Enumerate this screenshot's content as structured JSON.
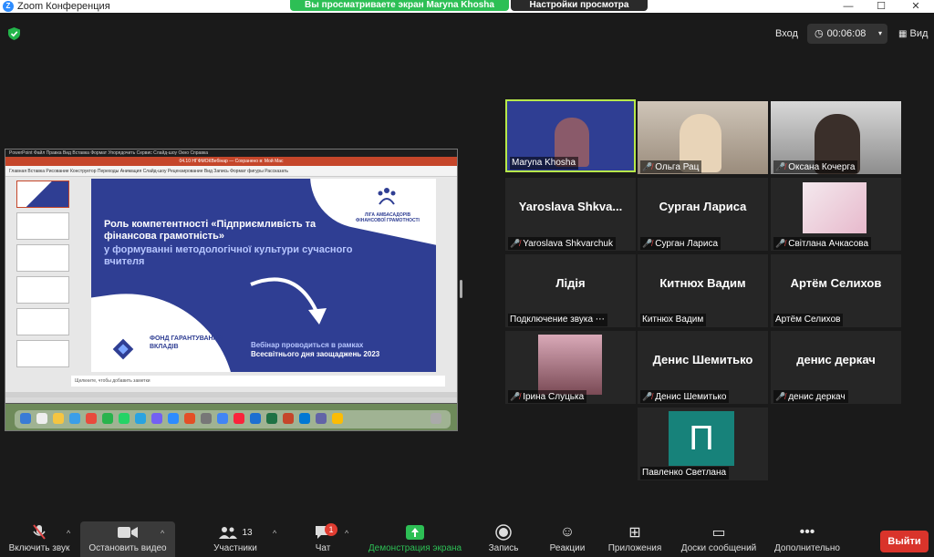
{
  "window": {
    "title": "Zoom Конференция",
    "share_banner": "Вы просматриваете экран Maryna Khosha",
    "view_options": "Настройки просмотра"
  },
  "topbar": {
    "enter_label": "Вход",
    "timer": "00:06:08",
    "view_label": "Вид"
  },
  "ppt": {
    "menubar": "PowerPoint   Файл   Правка   Вид   Вставка   Формат   Упорядочить   Сервис   Слайд-шоу   Окно   Справка",
    "doc_title": "04.10 НГФМОКВебінар — Сохранено в: Мой Mac",
    "ribbon": "Главная   Вставка   Рисование   Конструктор   Переходы   Анимация   Слайд-шоу   Рецензирование   Вид   Запись   Формат фигуры   Рассказать",
    "notes": "Щелкните, чтобы добавить заметки"
  },
  "slide": {
    "title": "Роль компетентності «Підприємливість та фінансова грамотність»",
    "subtitle": "у формуванні методологічної культури сучасного вчителя",
    "logo_text": "ЛІГА АМБАСАДОРІВ ФІНАНСОВОЇ ГРАМОТНОСТІ",
    "fund_text": "ФОНД ГАРАНТУВАННЯ ВКЛАДІВ",
    "webinar_line1": "Вебінар проводиться в рамках",
    "webinar_line2": "Всесвітнього дня заощаджень 2023"
  },
  "participants": [
    {
      "name": "Maryna Khosha",
      "tile_text": ""
    },
    {
      "name": "Ольга Рац",
      "tile_text": ""
    },
    {
      "name": "Оксана Кочерга",
      "tile_text": ""
    },
    {
      "name": "Yaroslava Shkvarchuk",
      "tile_text": "Yaroslava  Shkva..."
    },
    {
      "name": "Сурган Лариса",
      "tile_text": "Сурган Лариса"
    },
    {
      "name": "Світлана Ачкасова",
      "tile_text": ""
    },
    {
      "name": "Подключение звука",
      "tile_text": "Лідія"
    },
    {
      "name": "Китнюх Вадим",
      "tile_text": "Китнюх Вадим"
    },
    {
      "name": "Артём Селихов",
      "tile_text": "Артём Селихов"
    },
    {
      "name": "Ірина Слуцька",
      "tile_text": ""
    },
    {
      "name": "Денис Шемитько",
      "tile_text": "Денис Шемитько"
    },
    {
      "name": "денис деркач",
      "tile_text": "денис деркач"
    },
    {
      "name": "Павленко Светлана",
      "tile_text": "П"
    }
  ],
  "toolbar": {
    "mute": "Включить звук",
    "video": "Остановить видео",
    "participants": "Участники",
    "participants_count": "13",
    "chat": "Чат",
    "chat_badge": "1",
    "share": "Демонстрация экрана",
    "record": "Запись",
    "reactions": "Реакции",
    "apps": "Приложения",
    "whiteboards": "Доски сообщений",
    "more": "Дополнительно",
    "leave": "Выйти"
  },
  "colors": {
    "share_green": "#2dbf55",
    "slide_blue": "#2f3e93",
    "leave_red": "#d9342b",
    "active_speaker": "#b7e84a"
  }
}
